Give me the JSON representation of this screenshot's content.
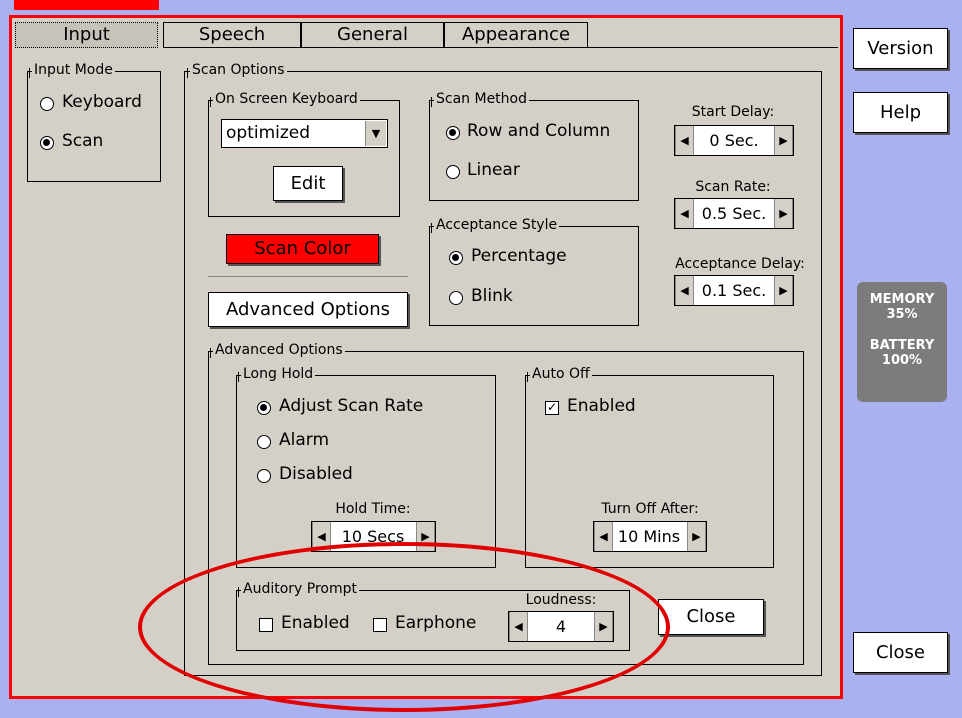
{
  "tabs": [
    "Input",
    "Speech",
    "General",
    "Appearance"
  ],
  "input_mode": {
    "legend": "Input Mode",
    "options": [
      {
        "label": "Keyboard",
        "selected": false
      },
      {
        "label": "Scan",
        "selected": true
      }
    ]
  },
  "scan_options": {
    "legend": "Scan Options",
    "on_screen_keyboard": {
      "legend": "On Screen Keyboard",
      "selected": "optimized",
      "edit_label": "Edit"
    },
    "scan_color_label": "Scan Color",
    "scan_color": "#ff0000",
    "advanced_button_label": "Advanced Options",
    "scan_method": {
      "legend": "Scan Method",
      "options": [
        {
          "label": "Row and Column",
          "selected": true
        },
        {
          "label": "Linear",
          "selected": false
        }
      ]
    },
    "acceptance_style": {
      "legend": "Acceptance Style",
      "options": [
        {
          "label": "Percentage",
          "selected": true
        },
        {
          "label": "Blink",
          "selected": false
        }
      ]
    },
    "start_delay": {
      "label": "Start Delay:",
      "value": "0 Sec."
    },
    "scan_rate": {
      "label": "Scan Rate:",
      "value": "0.5 Sec."
    },
    "acceptance_delay": {
      "label": "Acceptance Delay:",
      "value": "0.1 Sec."
    }
  },
  "advanced_options": {
    "legend": "Advanced Options",
    "long_hold": {
      "legend": "Long Hold",
      "options": [
        {
          "label": "Adjust Scan Rate",
          "selected": true
        },
        {
          "label": "Alarm",
          "selected": false
        },
        {
          "label": "Disabled",
          "selected": false
        }
      ],
      "hold_time_label": "Hold Time:",
      "hold_time_value": "10 Secs"
    },
    "auto_off": {
      "legend": "Auto Off",
      "enabled_label": "Enabled",
      "enabled": true,
      "turn_off_label": "Turn Off After:",
      "turn_off_value": "10 Mins"
    },
    "auditory_prompt": {
      "legend": "Auditory Prompt",
      "enabled_label": "Enabled",
      "enabled": false,
      "earphone_label": "Earphone",
      "earphone": false,
      "loudness_label": "Loudness:",
      "loudness_value": "4"
    },
    "close_label": "Close"
  },
  "side": {
    "version_label": "Version",
    "help_label": "Help",
    "memory_label": "MEMORY",
    "memory_value": "35%",
    "battery_label": "BATTERY",
    "battery_value": "100%",
    "close_label": "Close"
  }
}
